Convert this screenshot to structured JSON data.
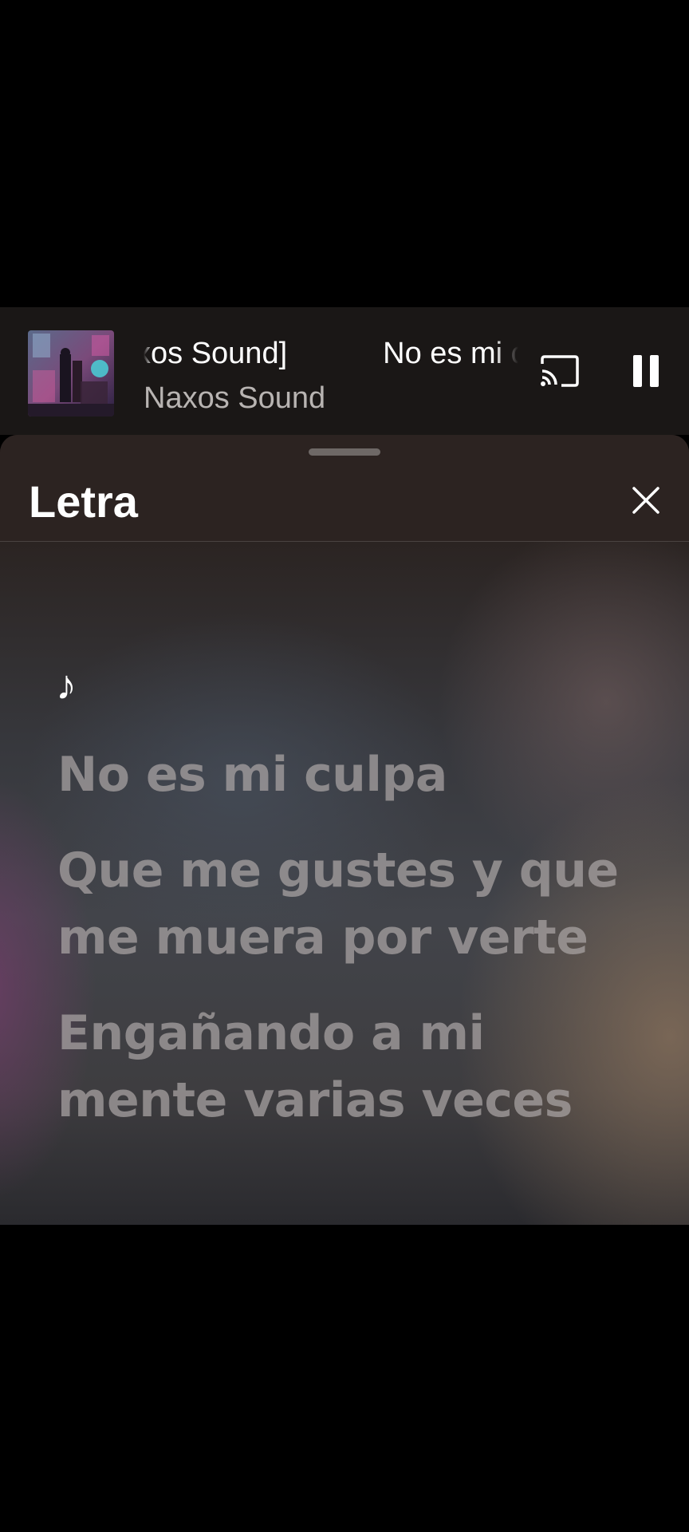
{
  "mini_player": {
    "track_title_marquee": [
      "xos Sound]",
      "No es mi culpa"
    ],
    "artist": "Naxos Sound",
    "cast_icon": "cast-icon",
    "pause_icon": "pause-icon"
  },
  "lyrics_sheet": {
    "title": "Letra",
    "close_icon": "close-icon",
    "music_note": "♪",
    "lines": [
      "No es mi culpa",
      "Que me gustes y que me muera por verte",
      "Engañando a mi mente varias veces"
    ]
  },
  "colors": {
    "background": "#000000",
    "mini_player_bg": "#1a1716",
    "sheet_header_bg": "#2c2321",
    "lyric_text": "#aaa5a5"
  }
}
